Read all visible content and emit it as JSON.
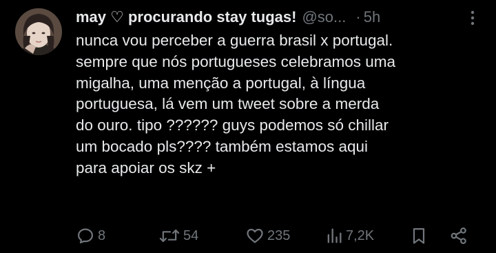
{
  "tweet": {
    "display_name": "may ♡ procurando stay tugas!",
    "handle": "@so...",
    "separator": "·",
    "time": "5h",
    "more_icon": "more-vertical-icon",
    "avatar": "profile-photo",
    "body_lines": [
      "nunca vou perceber a guerra brasil x portugal.",
      "sempre que nós portugueses celebramos uma",
      "migalha, uma menção a portugal, à língua",
      "portuguesa, lá vem um tweet sobre a merda",
      "do ouro. tipo ?????? guys podemos só chillar",
      "um bocado pls???? também estamos aqui",
      "para apoiar os skz +"
    ]
  },
  "actions": {
    "reply": {
      "icon": "reply-icon",
      "count": "8"
    },
    "retweet": {
      "icon": "retweet-icon",
      "count": "54"
    },
    "like": {
      "icon": "heart-icon",
      "count": "235"
    },
    "views": {
      "icon": "views-icon",
      "count": "7,2K"
    },
    "bookmark": {
      "icon": "bookmark-icon"
    },
    "share": {
      "icon": "share-icon"
    }
  },
  "colors": {
    "background": "#000000",
    "text_primary": "#e7e9ea",
    "text_secondary": "#71767b"
  }
}
